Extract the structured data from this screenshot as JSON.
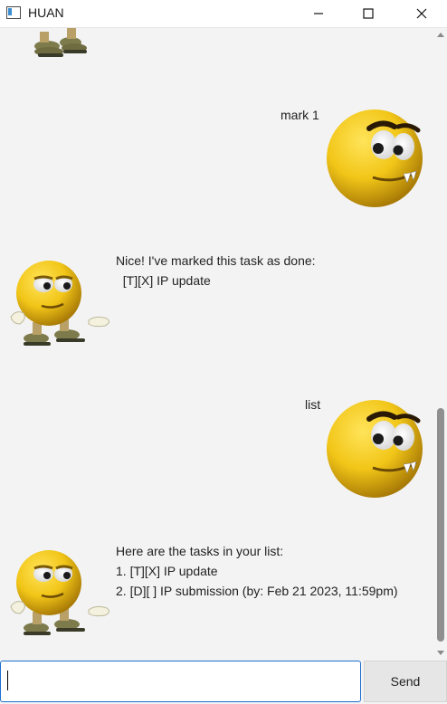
{
  "window": {
    "title": "HUAN"
  },
  "messages": [
    {
      "sender": "bot",
      "lines": []
    },
    {
      "sender": "user",
      "text": "mark 1"
    },
    {
      "sender": "bot",
      "lines": [
        "Nice! I've marked this task as done:",
        "  [T][X] IP update"
      ]
    },
    {
      "sender": "user",
      "text": "list"
    },
    {
      "sender": "bot",
      "lines": [
        "Here are the tasks in your list:",
        "1. [T][X] IP update",
        "2. [D][ ] IP submission (by: Feb 21 2023, 11:59pm)"
      ]
    }
  ],
  "input": {
    "value": "",
    "placeholder": ""
  },
  "send_button": {
    "label": "Send"
  },
  "colors": {
    "background": "#f3f3f3",
    "input_border": "#1d6fd0",
    "emoji_yellow": "#f2c618"
  }
}
